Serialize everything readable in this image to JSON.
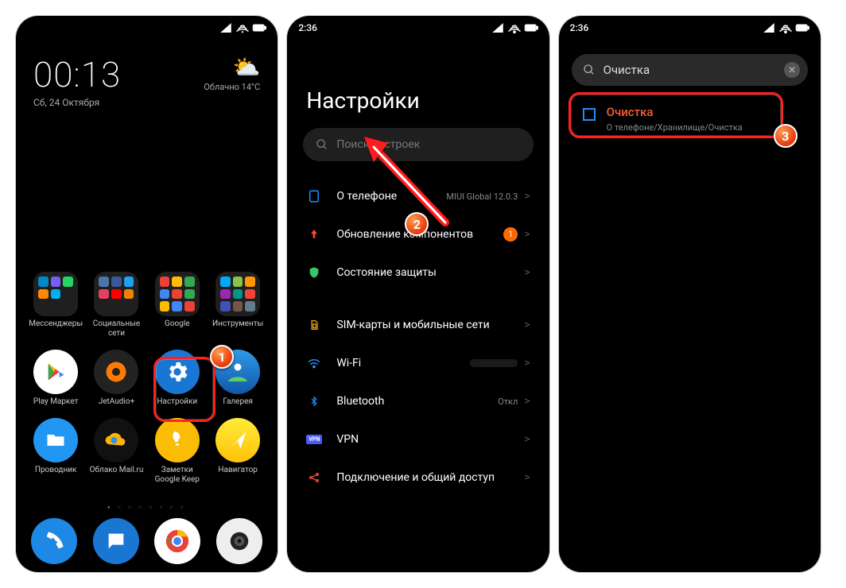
{
  "status": {
    "time": "2:36"
  },
  "phone1": {
    "clock": "00:13",
    "date": "Сб, 24 Октября",
    "weather_label": "Облачно 14°C",
    "folders": [
      "Мессенджеры",
      "Социальные сети",
      "Google",
      "Инструменты"
    ],
    "apps": [
      "Play Маркет",
      "JetAudio+",
      "Настройки",
      "Галерея",
      "Проводник",
      "Облако Mail.ru",
      "Заметки Google Keep",
      "Навигатор"
    ]
  },
  "phone2": {
    "title": "Настройки",
    "search_placeholder": "Поиск настроек",
    "rows": {
      "about": {
        "label": "О телефоне",
        "value": "MIUI Global 12.0.3"
      },
      "updates": {
        "label": "Обновление компонентов",
        "badge": "1"
      },
      "security": {
        "label": "Состояние защиты"
      },
      "sim": {
        "label": "SIM-карты и мобильные сети"
      },
      "wifi": {
        "label": "Wi-Fi"
      },
      "bt": {
        "label": "Bluetooth",
        "value": "Откл"
      },
      "vpn": {
        "label": "VPN"
      },
      "conn": {
        "label": "Подключение и общий доступ"
      }
    }
  },
  "phone3": {
    "query": "Очистка",
    "result_title": "Очистка",
    "result_path": "О телефоне/Хранилище/Очистка"
  },
  "callouts": {
    "one": "1",
    "two": "2",
    "three": "3"
  }
}
